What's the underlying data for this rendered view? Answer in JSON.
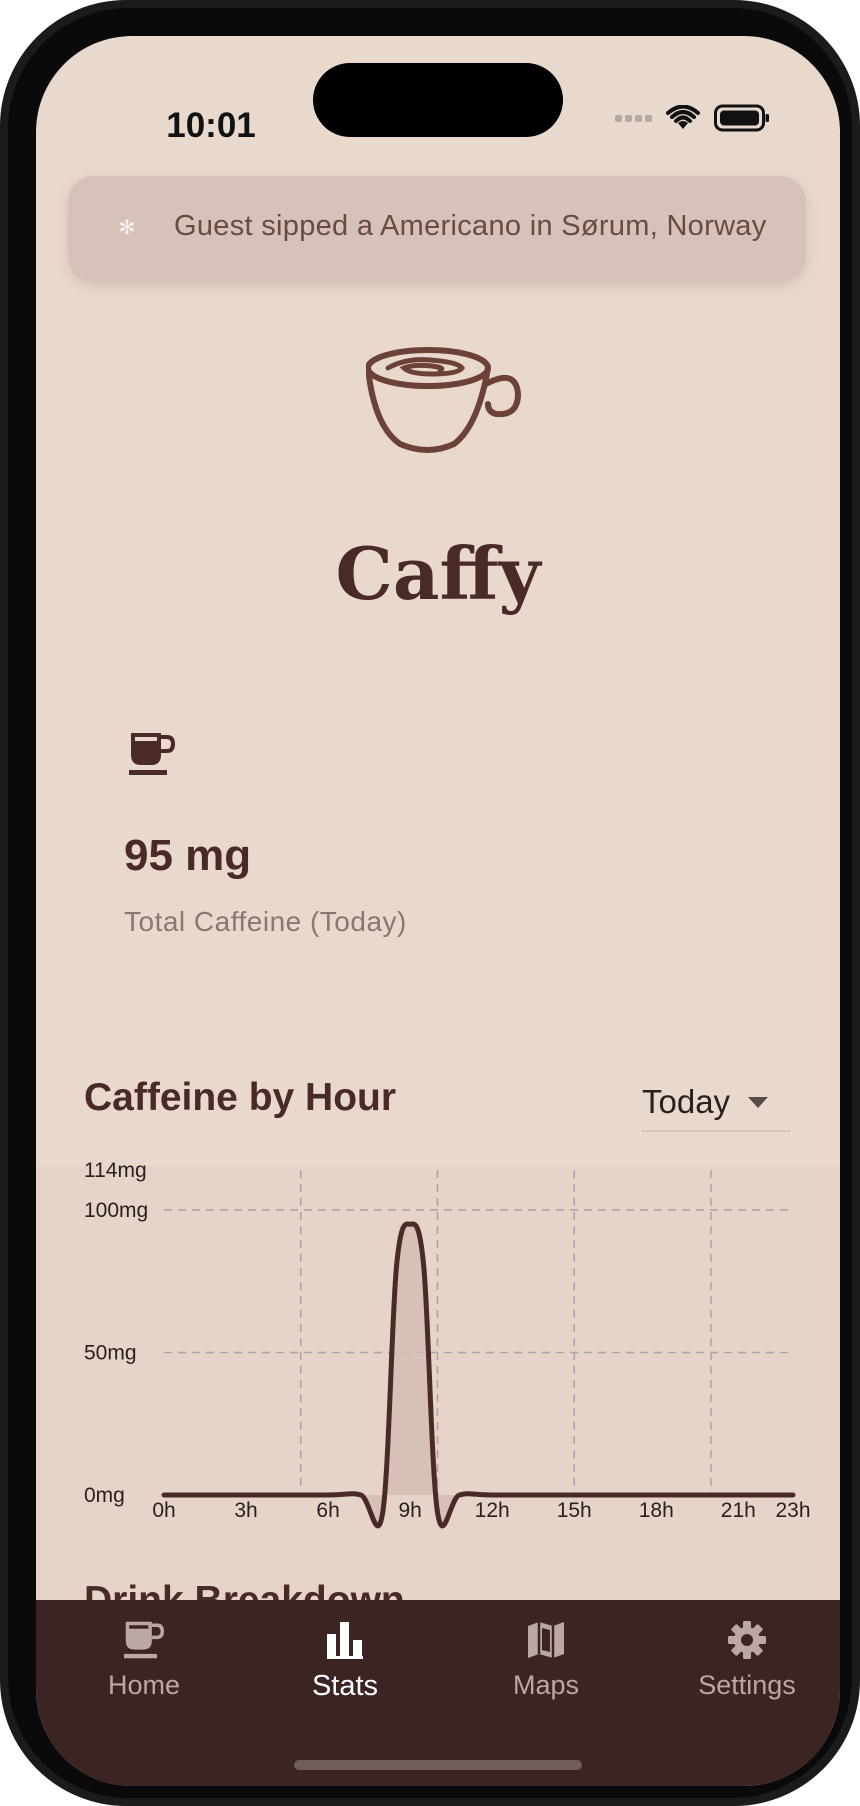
{
  "status_bar": {
    "time": "10:01"
  },
  "toast": {
    "message": "Guest sipped a Americano in Sørum, Norway"
  },
  "app": {
    "title": "Caffy"
  },
  "summary": {
    "value": "95 mg",
    "label": "Total Caffeine (Today)"
  },
  "chart_section": {
    "title": "Caffeine by Hour",
    "range": "Today"
  },
  "next_section": {
    "title": "Drink Breakdown"
  },
  "colors": {
    "background": "#e9d9cd",
    "brand": "#4a2a26",
    "tabbar": "#3c2422"
  },
  "chart_data": {
    "type": "area",
    "x": [
      0,
      3,
      6,
      7.2,
      8,
      8.5,
      9,
      9.5,
      10,
      10.8,
      12,
      15,
      18,
      21,
      23
    ],
    "values": [
      0,
      0,
      0,
      0,
      -6,
      80,
      95,
      80,
      -6,
      0,
      0,
      0,
      0,
      0,
      0
    ],
    "x_ticks": [
      "0h",
      "3h",
      "6h",
      "9h",
      "12h",
      "15h",
      "18h",
      "21h",
      "23h"
    ],
    "y_ticks": [
      "0mg",
      "50mg",
      "100mg",
      "114mg"
    ],
    "ylim": [
      0,
      114
    ],
    "xlim": [
      0,
      23
    ],
    "grid": true
  },
  "tabs": [
    {
      "label": "Home",
      "icon": "coffee-cup-icon",
      "active": false
    },
    {
      "label": "Stats",
      "icon": "bar-chart-icon",
      "active": true
    },
    {
      "label": "Maps",
      "icon": "map-icon",
      "active": false
    },
    {
      "label": "Settings",
      "icon": "gear-icon",
      "active": false
    }
  ]
}
